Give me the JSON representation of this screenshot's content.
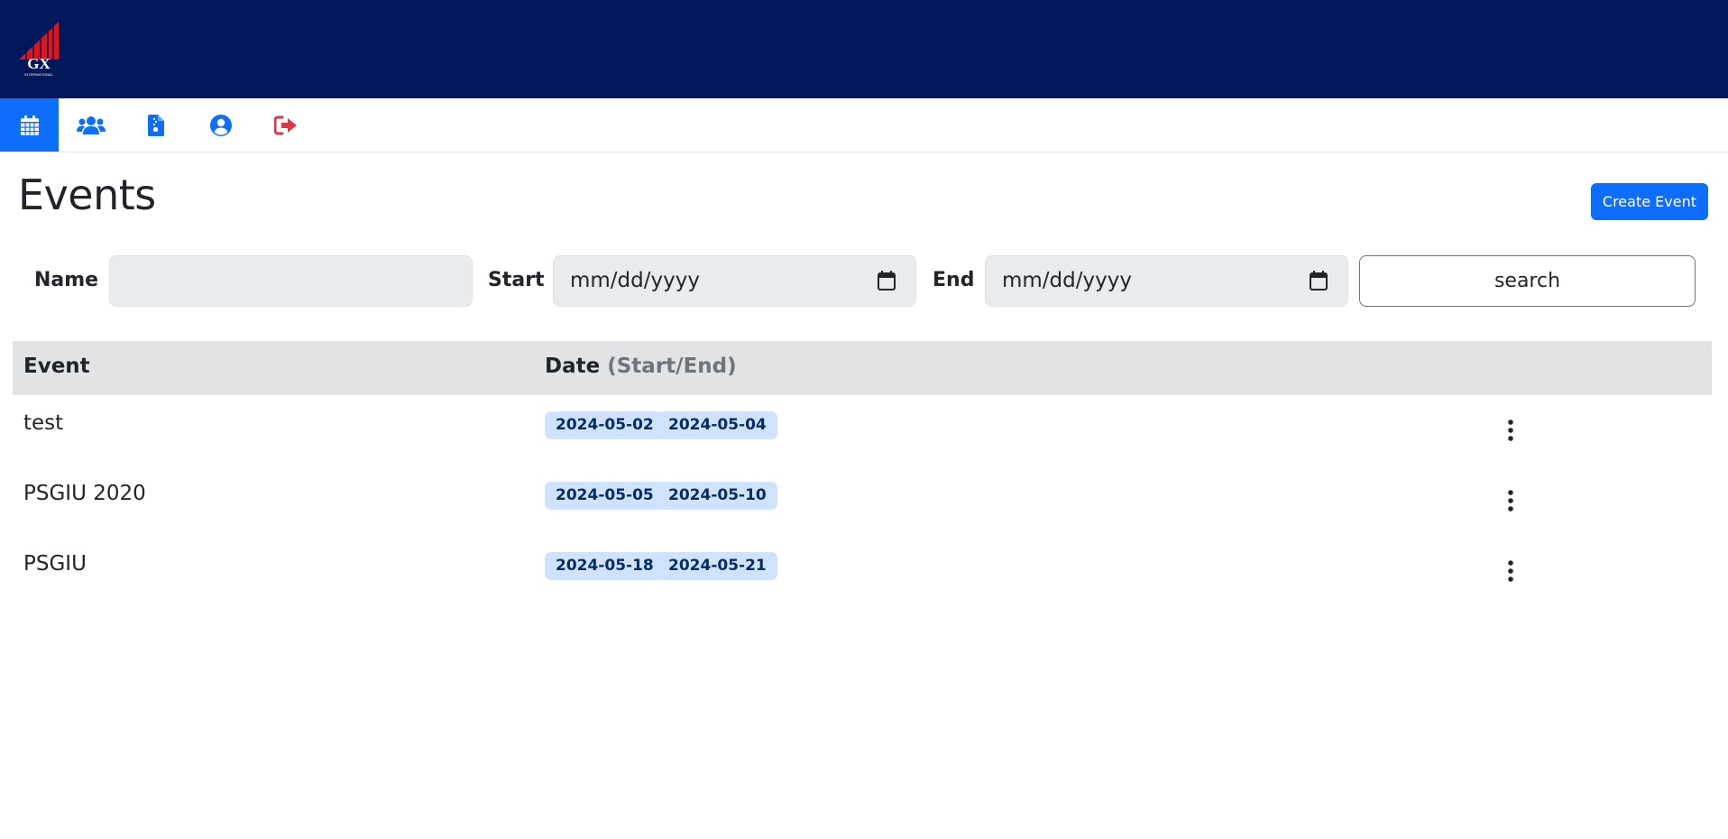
{
  "brand": {
    "logo_text": "GX",
    "logo_subtext": "INTERNATIONAL"
  },
  "nav": [
    {
      "icon": "calendar-icon",
      "active": true
    },
    {
      "icon": "users-icon",
      "active": false
    },
    {
      "icon": "file-icon",
      "active": false
    },
    {
      "icon": "user-circle-icon",
      "active": false
    },
    {
      "icon": "logout-icon",
      "active": false,
      "color": "#dc3545"
    }
  ],
  "page": {
    "title": "Events",
    "create_label": "Create Event"
  },
  "filters": {
    "name_label": "Name",
    "name_value": "",
    "start_label": "Start",
    "start_placeholder": "mm/dd/yyyy",
    "end_label": "End",
    "end_placeholder": "mm/dd/yyyy",
    "search_label": "search"
  },
  "table": {
    "col_event": "Event",
    "col_date": "Date",
    "col_date_hint": "(Start/End)",
    "rows": [
      {
        "name": "test",
        "start": "2024-05-02",
        "end": "2024-05-04"
      },
      {
        "name": "PSGIU 2020",
        "start": "2024-05-05",
        "end": "2024-05-10"
      },
      {
        "name": "PSGIU",
        "start": "2024-05-18",
        "end": "2024-05-21"
      }
    ]
  },
  "colors": {
    "header_bg": "#00175a",
    "primary": "#0d6efd",
    "danger": "#dc3545",
    "badge_bg": "#cfe2ff",
    "badge_text": "#052c65"
  }
}
